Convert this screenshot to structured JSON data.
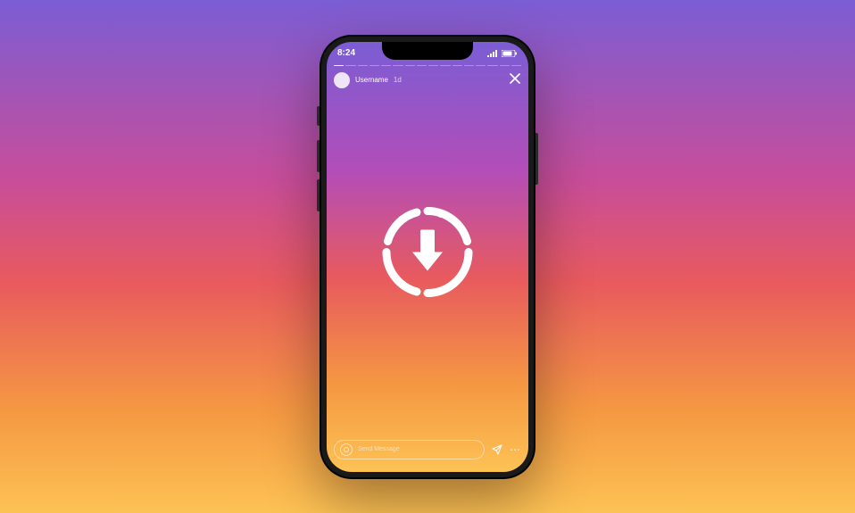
{
  "statusBar": {
    "time": "8:24"
  },
  "story": {
    "username": "Username",
    "timestamp": "1d",
    "messagePlaceholder": "Send Message",
    "progressSegments": 16
  }
}
